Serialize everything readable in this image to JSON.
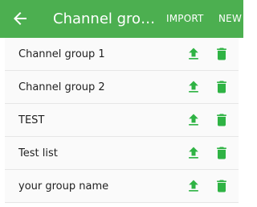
{
  "appbar": {
    "back_icon": "arrow-left-icon",
    "title": "Channel group list",
    "import_label": "IMPORT",
    "new_label": "NEW",
    "bg_color": "#4caf50"
  },
  "groups": [
    {
      "label": "Channel group 1"
    },
    {
      "label": "Channel group 2"
    },
    {
      "label": "TEST"
    },
    {
      "label": "Test list"
    },
    {
      "label": "your group name"
    }
  ],
  "row_icons": {
    "upload": "upload-icon",
    "delete": "trash-icon",
    "color": "#2fb344"
  }
}
